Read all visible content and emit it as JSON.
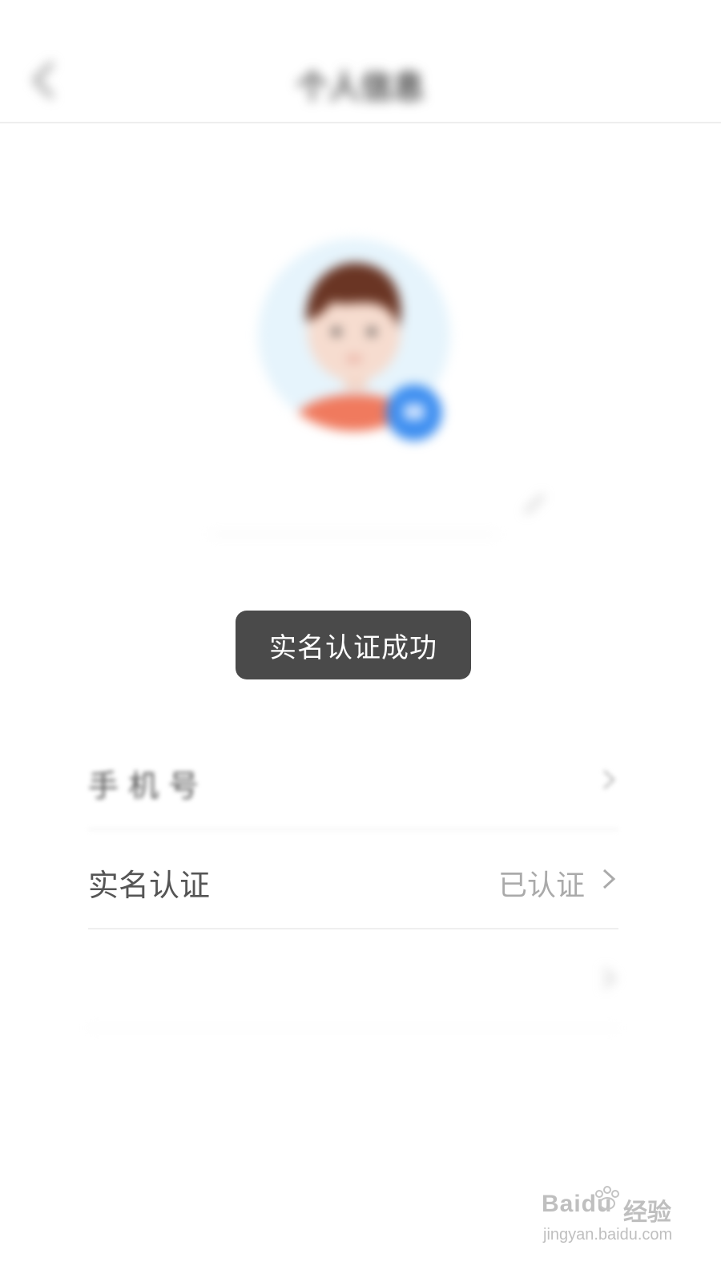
{
  "status_bar": {
    "left_text": "",
    "right_text": ""
  },
  "header": {
    "title": "个人信息",
    "back_icon": "chevron-left-icon"
  },
  "profile": {
    "avatar_icon": "avatar-illustration",
    "camera_icon": "camera-icon",
    "nickname": "",
    "edit_icon": "pencil-icon"
  },
  "toast": {
    "text": "实名认证成功"
  },
  "info_list": [
    {
      "label": "手 机 号",
      "value": "",
      "value_color": "#aaaaaa"
    },
    {
      "label": "实名认证",
      "value": "已认证",
      "value_color": "#aaaaaa"
    },
    {
      "label": "",
      "value": "",
      "value_color": "#ff4a55"
    }
  ],
  "footer_links": [
    "",
    ""
  ],
  "watermark": {
    "logo": "Baidu",
    "cn": "经验",
    "url": "jingyan.baidu.com"
  },
  "colors": {
    "toast_bg": "#4a4a4a",
    "camera_badge": "#3d8ef0",
    "avatar_bg": "#e6f4fc",
    "highlight_red": "#ff4a55"
  }
}
